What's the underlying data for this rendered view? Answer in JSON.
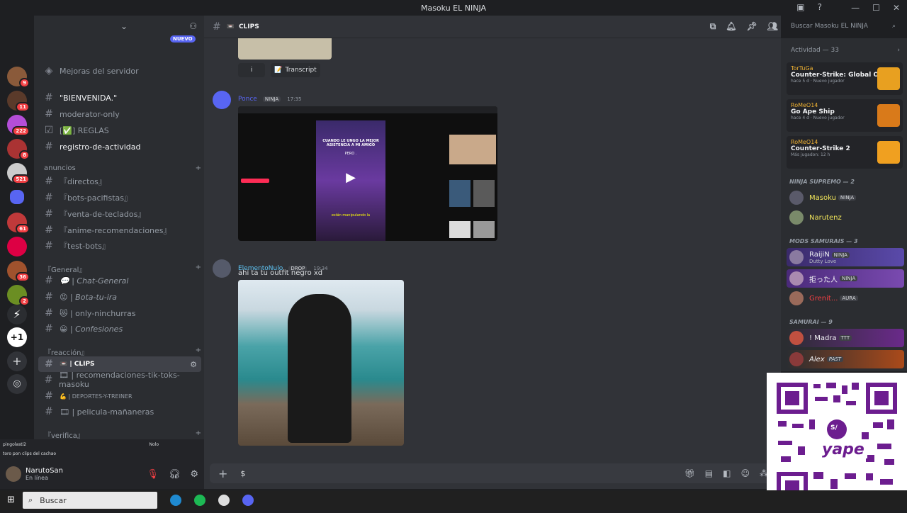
{
  "window": {
    "title": "Masoku EL NINJA"
  },
  "channel_header": {
    "name": "CLIPS",
    "search_placeholder": "Buscar Masoku EL NINJA"
  },
  "sidebar": {
    "new_badge": "NUEVO",
    "server_boost": "Mejoras del servidor",
    "channels": [
      {
        "label": "\"BIENVENIDA.\""
      },
      {
        "label": "moderator-only"
      },
      {
        "label": "[✅] REGLAS"
      },
      {
        "label": "registro-de-actividad"
      }
    ],
    "categories": [
      {
        "label": "anuncios"
      },
      {
        "label": "『General』"
      },
      {
        "label": "『reacción』"
      },
      {
        "label": "『verifica』"
      }
    ],
    "anuncios_channels": [
      {
        "label": "『directos』"
      },
      {
        "label": "『bots-pacifistas』"
      },
      {
        "label": "『venta-de-teclados』"
      },
      {
        "label": "『anime-recomendaciones』"
      },
      {
        "label": "『test-bots』"
      }
    ],
    "general_channels": [
      {
        "label": "💬 | Chat-General"
      },
      {
        "label": "😡 | Bota-tu-ira"
      },
      {
        "label": "😻 | only-ninchurras"
      },
      {
        "label": "😀 | Confesiones"
      }
    ],
    "reaccion_channels": [
      {
        "label": "📼 | CLIPS"
      },
      {
        "label": "🎞 | recomendaciones-tik-toks-masoku"
      },
      {
        "label": "💪 | DEPORTES-Y-TREINER"
      },
      {
        "label": "🎞 | pelicula-mañaneras"
      }
    ],
    "guild_badges": [
      "9",
      "11",
      "222",
      "8",
      "521",
      "61",
      "36",
      "2"
    ]
  },
  "status_bar": {
    "text": "toro pon clips del cachao",
    "user_tag": "pingolasti2",
    "right_tag": "Nolo"
  },
  "user": {
    "name": "NarutoSan",
    "status": "En línea"
  },
  "messages": [
    {
      "buttons": {
        "info": "i",
        "transcript": "Transcript"
      }
    },
    {
      "author": "Ponce",
      "tag": "NINJA",
      "time": "17:35",
      "tiktok_caption": "CUANDO LE UNGO LA MEJOR ASISTENCIA A MI AMIGO",
      "tiktok_sub": "PERO .",
      "tiktok_bottom": "están manipulando la"
    },
    {
      "author": "ElementoNulo",
      "tag": "DROP",
      "time": "19:34",
      "text": "ahi ta tu outfit negro xd"
    }
  ],
  "chat_input": {
    "value": "$"
  },
  "members": {
    "activity": "Actividad — 33",
    "cards": [
      {
        "user": "TorTuGa",
        "game": "Counter-Strike: Global Off...",
        "meta": "hace 5 d  ·  Nuevo jugador"
      },
      {
        "user": "RoMeO14",
        "game": "Go Ape Ship",
        "meta": "hace 4 d  ·  Nuevo jugador"
      },
      {
        "user": "RoMeO14",
        "game": "Counter-Strike 2",
        "meta": "Más jugadon: 12 h"
      }
    ],
    "roles": [
      {
        "label": "NINJA SUPREMO — 2"
      },
      {
        "label": "MODS SAMURAIS — 3"
      },
      {
        "label": "SAMURAI — 9"
      }
    ],
    "list": [
      {
        "name": "Masoku",
        "tag": "NINJA",
        "sub": ""
      },
      {
        "name": "Narutenz",
        "tag": "",
        "sub": ""
      },
      {
        "name": "RaijiN",
        "tag": "NINJA",
        "sub": "Dutty Love"
      },
      {
        "name": "拒った人",
        "tag": "NINJA",
        "sub": ""
      },
      {
        "name": "Grenit...",
        "tag": "AURA",
        "sub": ""
      },
      {
        "name": "! Madra",
        "tag": "TTT",
        "sub": ""
      },
      {
        "name": "Alex",
        "tag": "PAST",
        "sub": ""
      }
    ]
  },
  "qr": {
    "brand": "yape",
    "icon_text": "S/"
  },
  "taskbar": {
    "search": "Buscar"
  },
  "colors": {
    "accent": "#5865f2",
    "online": "#23a55a",
    "danger": "#f23f43",
    "qr_purple": "#6c1d8f"
  }
}
